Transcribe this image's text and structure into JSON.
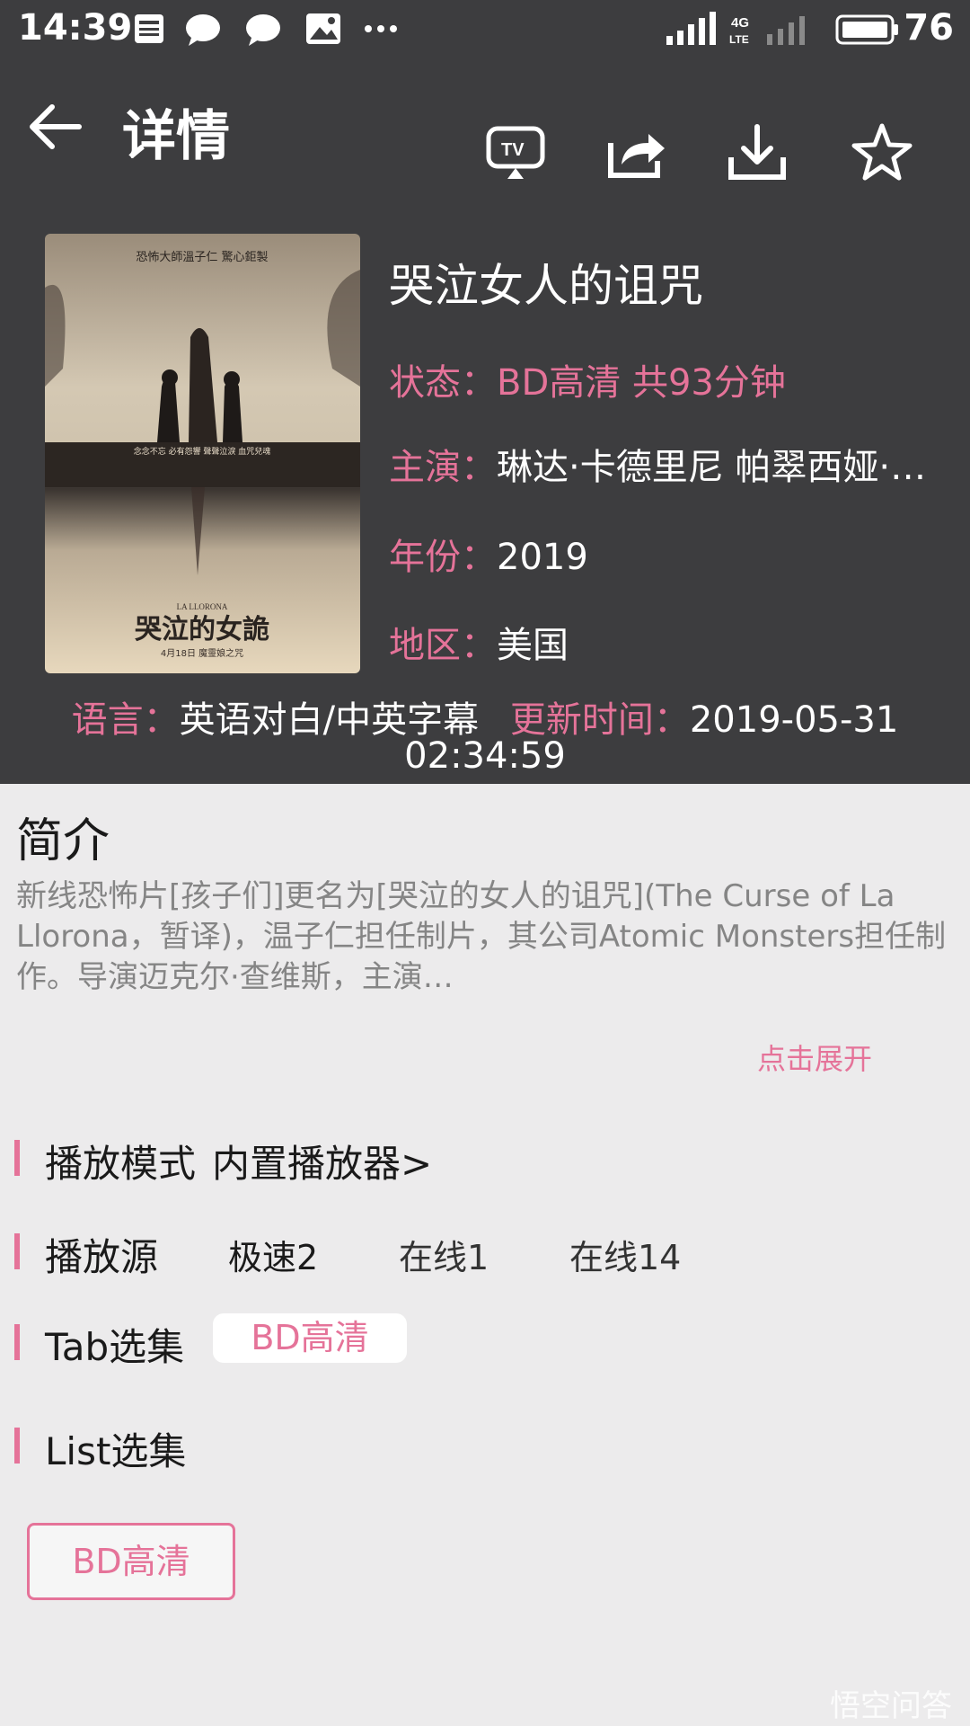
{
  "status_bar": {
    "time": "14:39",
    "battery": "76",
    "network": "4G LTE"
  },
  "header": {
    "title": "详情",
    "icons": [
      "back-arrow-icon",
      "tv-cast-icon",
      "share-icon",
      "download-icon",
      "star-icon"
    ]
  },
  "movie": {
    "title": "哭泣女人的诅咒",
    "status_label": "状态：",
    "status_value": "BD高清 共93分钟",
    "cast_label": "主演：",
    "cast_value": "琳达·卡德里尼 帕翠西娅·…",
    "year_label": "年份：",
    "year_value": "2019",
    "region_label": "地区：",
    "region_value": "美国",
    "language_label": "语言：",
    "language_value": "英语对白/中英字幕",
    "updated_label": "更新时间：",
    "updated_date": "2019-05-31",
    "updated_time": "02:34:59"
  },
  "poster": {
    "top_text": "恐怖大師溫子仁 驚心鉅製",
    "tagline": "念念不忘 必有怨響  聲聲泣淚 血咒兒魂",
    "small_title": "LA LLORONA",
    "title": "哭泣的女詭",
    "date": "4月18日 魔靈娘之咒"
  },
  "intro": {
    "title": "简介",
    "text": "新线恐怖片[孩子们]更名为[哭泣的女人的诅咒](The Curse of La Llorona，暂译)，温子仁担任制片，其公司Atomic Monsters担任制作。导演迈克尔·查维斯，主演…",
    "expand_label": "点击展开"
  },
  "play_mode": {
    "label": "播放模式",
    "value": "内置播放器>"
  },
  "play_source": {
    "label": "播放源",
    "options": [
      "极速2",
      "在线1",
      "在线14"
    ]
  },
  "tab_episodes": {
    "label": "Tab选集",
    "chip": "BD高清"
  },
  "list_episodes": {
    "label": "List选集",
    "button": "BD高清"
  },
  "watermark": "悟空问答",
  "colors": {
    "accent": "#e57399",
    "header_bg": "#3d3d3f",
    "body_bg": "#ecebec"
  }
}
